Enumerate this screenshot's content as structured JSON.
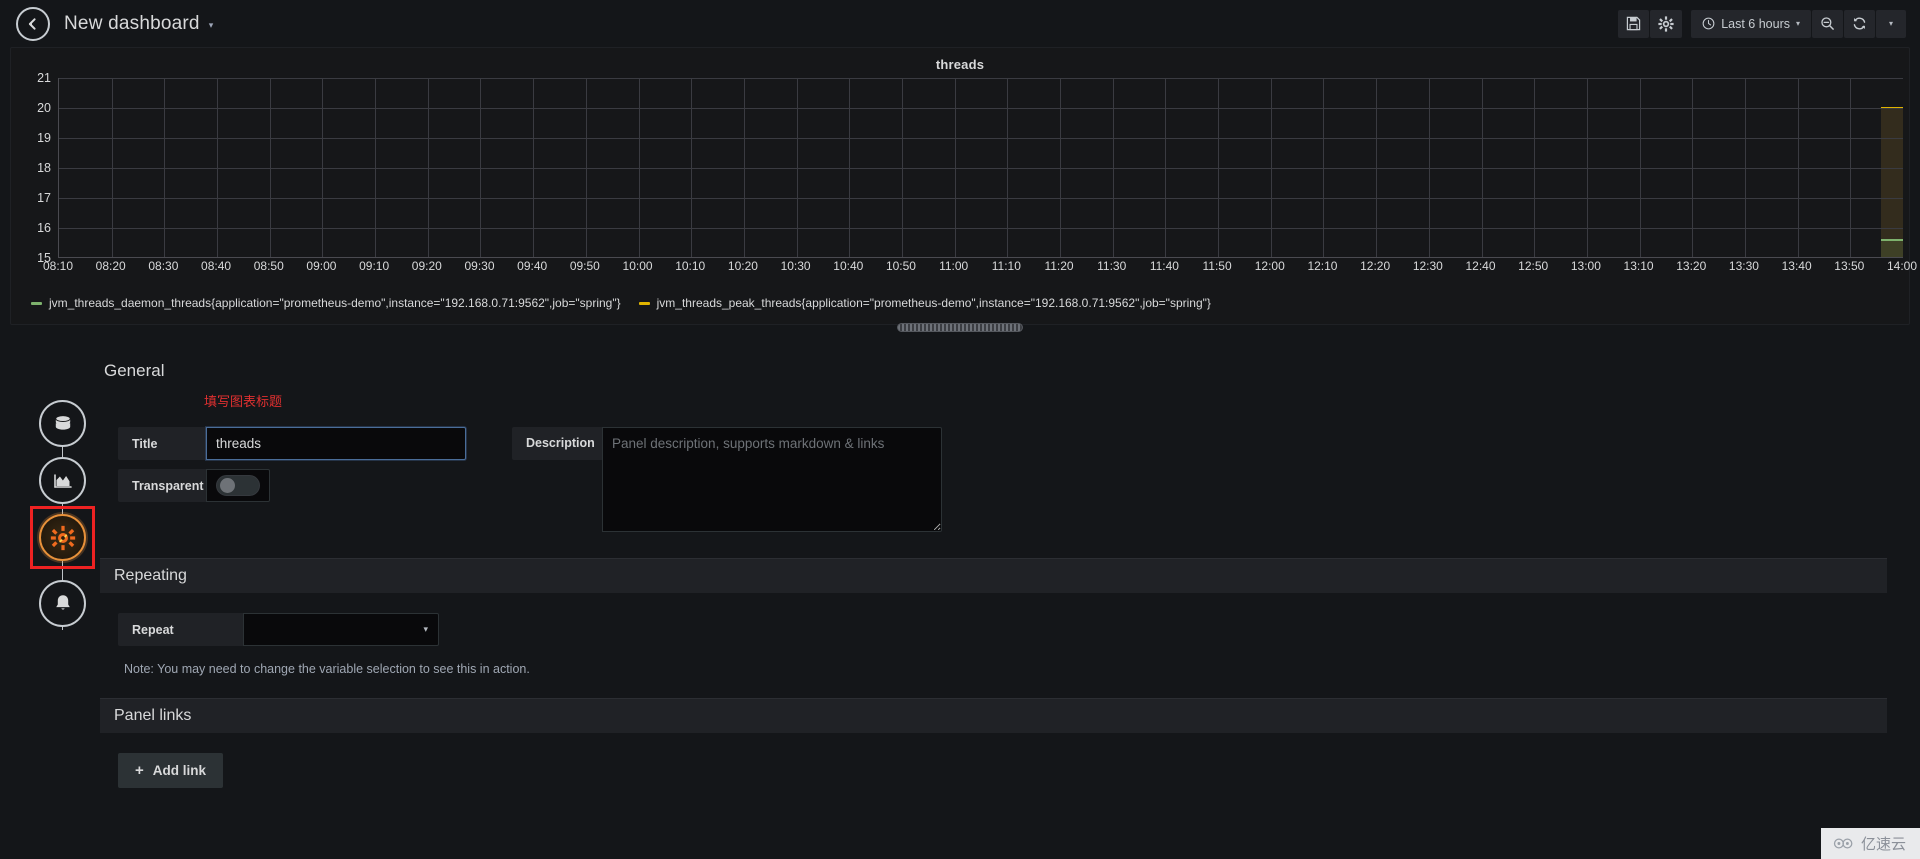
{
  "navbar": {
    "back_icon": "arrow-left-icon",
    "title": "New dashboard",
    "title_caret": "▾",
    "save_icon": "save-floppy-icon",
    "settings_icon": "gear-icon",
    "time_clock_icon": "clock-icon",
    "time_range": "Last 6 hours",
    "time_caret": "▾",
    "zoom_out_icon": "zoom-out-icon",
    "refresh_icon": "refresh-icon",
    "refresh_caret": "▾"
  },
  "graph_panel": {
    "title": "threads",
    "resize_handle": "panel-resize-handle"
  },
  "chart_data": {
    "type": "line",
    "title": "threads",
    "xlabel": "",
    "ylabel": "",
    "ylim": [
      15,
      21
    ],
    "yticks": [
      21,
      20,
      19,
      18,
      17,
      16,
      15
    ],
    "grid": true,
    "legend_position": "bottom",
    "xticks": [
      "08:10",
      "08:20",
      "08:30",
      "08:40",
      "08:50",
      "09:00",
      "09:10",
      "09:20",
      "09:30",
      "09:40",
      "09:50",
      "10:00",
      "10:10",
      "10:20",
      "10:30",
      "10:40",
      "10:50",
      "11:00",
      "11:10",
      "11:20",
      "11:30",
      "11:40",
      "11:50",
      "12:00",
      "12:10",
      "12:20",
      "12:30",
      "12:40",
      "12:50",
      "13:00",
      "13:10",
      "13:20",
      "13:30",
      "13:40",
      "13:50",
      "14:00"
    ],
    "series": [
      {
        "name": "jvm_threads_daemon_threads{application=\"prometheus-demo\",instance=\"192.168.0.71:9562\",job=\"spring\"}",
        "color": "#7eb26d",
        "value_at_end": 15.6,
        "coverage_note": "data present only at far right edge of window"
      },
      {
        "name": "jvm_threads_peak_threads{application=\"prometheus-demo\",instance=\"192.168.0.71:9562\",job=\"spring\"}",
        "color": "#e0b400",
        "value_at_end": 20.0,
        "coverage_note": "data present only at far right edge of window"
      }
    ]
  },
  "edit_sidebar": {
    "items": [
      {
        "name": "queries",
        "icon": "database-icon",
        "active": false
      },
      {
        "name": "visualization",
        "icon": "chart-area-icon",
        "active": false
      },
      {
        "name": "general",
        "icon": "gear-wrench-icon",
        "active": true
      },
      {
        "name": "alert",
        "icon": "bell-icon",
        "active": false
      }
    ]
  },
  "options": {
    "general_heading": "General",
    "title_hint": "填写图表标题",
    "title_label": "Title",
    "title_value": "threads",
    "transparent_label": "Transparent",
    "transparent_on": false,
    "description_label": "Description",
    "description_value": "",
    "description_placeholder": "Panel description, supports markdown & links",
    "repeating_heading": "Repeating",
    "repeat_label": "Repeat",
    "repeat_value": "",
    "repeat_caret": "▾",
    "repeat_note": "Note: You may need to change the variable selection to see this in action.",
    "panel_links_heading": "Panel links",
    "add_link_label": "Add link",
    "add_link_plus": "+"
  },
  "watermark": {
    "text": "亿速云",
    "icon": "cloud-logo-icon"
  },
  "colors": {
    "accent_orange": "#e8913a",
    "annotation_red": "#ee2222",
    "series_green": "#7eb26d",
    "series_yellow": "#e0b400",
    "panel_bg": "#161719",
    "app_bg": "#141619"
  }
}
